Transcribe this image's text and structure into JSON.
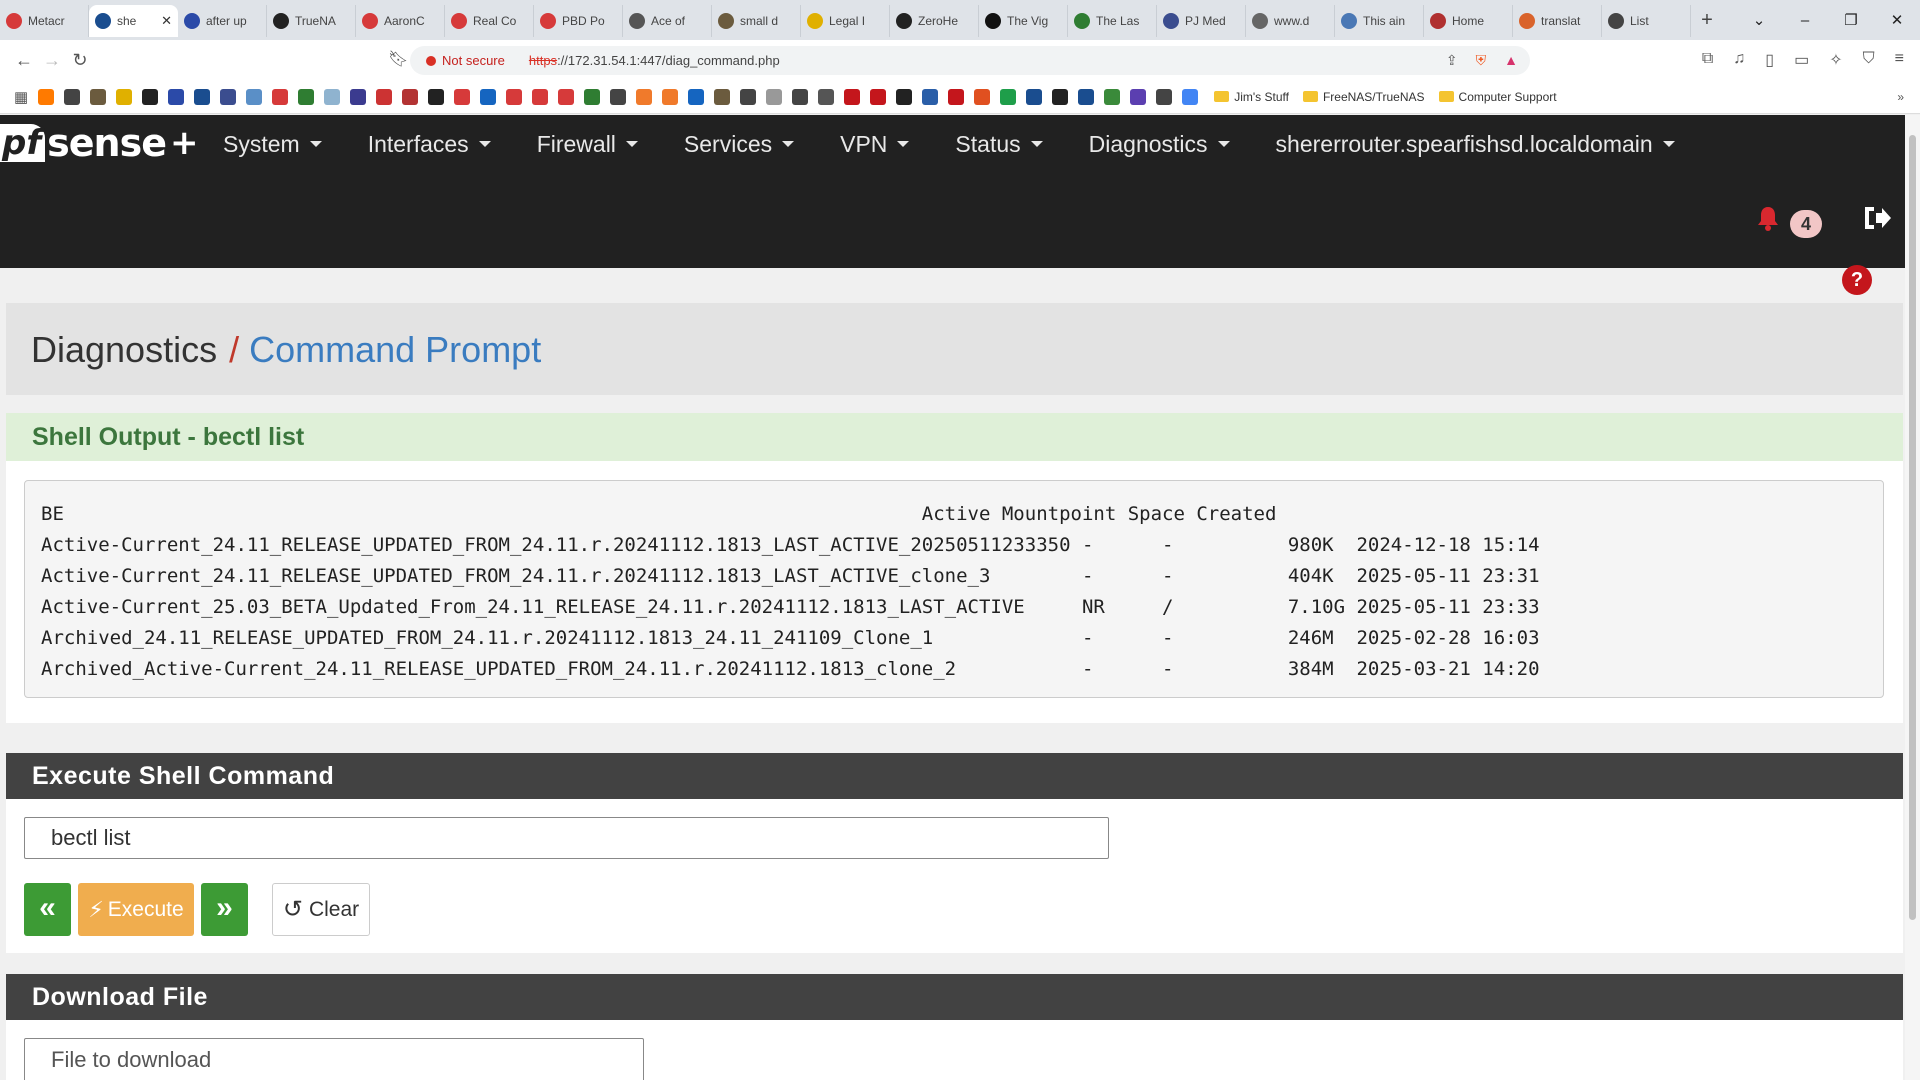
{
  "browser": {
    "tabs": [
      {
        "label": "Metacr",
        "color": "#d63a3a"
      },
      {
        "label": "she",
        "color": "#1a4d8f",
        "active": true
      },
      {
        "label": "after up",
        "color": "#2b4aa8"
      },
      {
        "label": "TrueNA",
        "color": "#222222"
      },
      {
        "label": "AaronC",
        "color": "#d63a3a"
      },
      {
        "label": "Real Co",
        "color": "#d63a3a"
      },
      {
        "label": "PBD Po",
        "color": "#d63a3a"
      },
      {
        "label": "Ace of",
        "color": "#555555"
      },
      {
        "label": "small d",
        "color": "#6b5b3e"
      },
      {
        "label": "Legal I",
        "color": "#e0b000"
      },
      {
        "label": "ZeroHe",
        "color": "#222222"
      },
      {
        "label": "The Vig",
        "color": "#111111"
      },
      {
        "label": "The Las",
        "color": "#2f7d32"
      },
      {
        "label": "PJ Med",
        "color": "#3b4d8f"
      },
      {
        "label": "www.d",
        "color": "#666666"
      },
      {
        "label": "This ain",
        "color": "#4a78b5"
      },
      {
        "label": "Home",
        "color": "#b03030"
      },
      {
        "label": "translat",
        "color": "#d9632b"
      },
      {
        "label": "List",
        "color": "#444444"
      }
    ],
    "url": {
      "security_label": "Not secure",
      "protocol": "https",
      "rest": "://172.31.54.1:447/diag_command.php"
    },
    "bookmarks": {
      "icon_colors": [
        "#ff7a00",
        "#444444",
        "#6b5b3e",
        "#e0b000",
        "#222222",
        "#2b4aa8",
        "#1a4d8f",
        "#3b4d8f",
        "#5a8fc7",
        "#d63a3a",
        "#2f7d32",
        "#8fb3cf",
        "#3b3b8f",
        "#cc3333",
        "#b33333",
        "#222222",
        "#d63a3a",
        "#1565c0",
        "#d63a3a",
        "#d63a3a",
        "#d63a3a",
        "#2f7d32",
        "#444444",
        "#f07a2b",
        "#f07a2b",
        "#1565c0",
        "#6b5b3e",
        "#444444",
        "#999999",
        "#444444",
        "#555555",
        "#c4161c",
        "#c4161c",
        "#222222",
        "#2a5ea8",
        "#c4161c",
        "#e05020",
        "#1e9e4a",
        "#1a4d8f",
        "#222222",
        "#1a4d8f",
        "#3a8a3a",
        "#5b3fb0",
        "#444444",
        "#4285f4"
      ],
      "folders": [
        "Jim's Stuff",
        "FreeNAS/TrueNAS",
        "Computer Support"
      ]
    }
  },
  "pfsense": {
    "logo": {
      "pf": "pf",
      "sense": "sense",
      "plus": "+"
    },
    "menu": [
      "System",
      "Interfaces",
      "Firewall",
      "Services",
      "VPN",
      "Status",
      "Diagnostics",
      "shererrouter.spearfishsd.localdomain"
    ],
    "notification_count": "4",
    "breadcrumb": {
      "parent": "Diagnostics",
      "separator": "/",
      "current": "Command Prompt"
    },
    "help_label": "?",
    "shell_output": {
      "title": "Shell Output - bectl list",
      "lines": [
        "BE                                                                           Active Mountpoint Space Created",
        "Active-Current_24.11_RELEASE_UPDATED_FROM_24.11.r.20241112.1813_LAST_ACTIVE_20250511233350 -      -          980K  2024-12-18 15:14",
        "Active-Current_24.11_RELEASE_UPDATED_FROM_24.11.r.20241112.1813_LAST_ACTIVE_clone_3        -      -          404K  2025-05-11 23:31",
        "Active-Current_25.03_BETA_Updated_From_24.11_RELEASE_24.11.r.20241112.1813_LAST_ACTIVE     NR     /          7.10G 2025-05-11 23:33",
        "Archived_24.11_RELEASE_UPDATED_FROM_24.11.r.20241112.1813_24.11_241109_Clone_1             -      -          246M  2025-02-28 16:03",
        "Archived_Active-Current_24.11_RELEASE_UPDATED_FROM_24.11.r.20241112.1813_clone_2           -      -          384M  2025-03-21 14:20"
      ]
    },
    "execute": {
      "title": "Execute Shell Command",
      "command_value": "bectl list",
      "execute_label": "Execute",
      "clear_label": "Clear"
    },
    "download": {
      "title": "Download File",
      "placeholder": "File to download"
    }
  }
}
